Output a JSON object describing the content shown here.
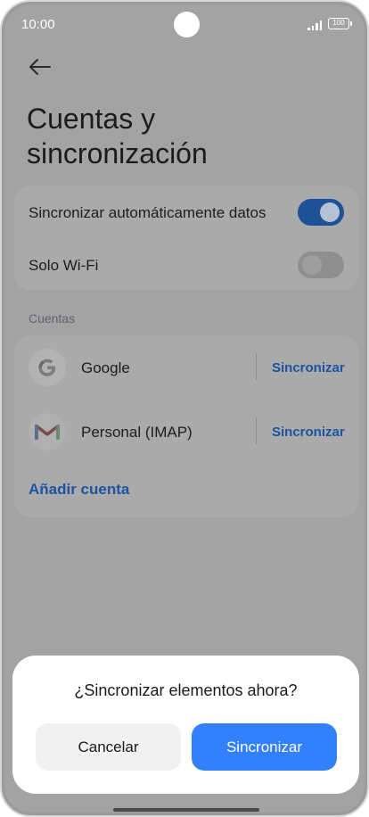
{
  "status_bar": {
    "time": "10:00",
    "battery": "100"
  },
  "page": {
    "title": "Cuentas y sincronización"
  },
  "sync_settings": {
    "auto_sync": {
      "label": "Sincronizar automáticamente datos",
      "enabled": true
    },
    "wifi_only": {
      "label": "Solo Wi-Fi",
      "enabled": false
    }
  },
  "accounts": {
    "section_label": "Cuentas",
    "items": [
      {
        "name": "Google",
        "icon": "google-icon",
        "action": "Sincronizar"
      },
      {
        "name": "Personal (IMAP)",
        "icon": "gmail-icon",
        "action": "Sincronizar"
      }
    ],
    "add_label": "Añadir cuenta"
  },
  "dialog": {
    "title": "¿Sincronizar elementos ahora?",
    "cancel_label": "Cancelar",
    "confirm_label": "Sincronizar"
  },
  "colors": {
    "accent": "#3380fc",
    "link": "#1d54a1",
    "scrim": "#9b9b9b"
  }
}
